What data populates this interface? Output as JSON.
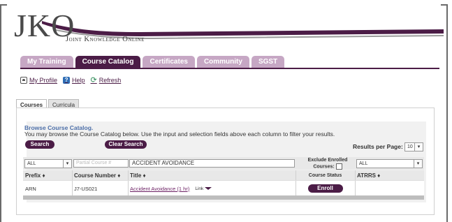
{
  "header": {
    "logo_text": "JKO",
    "logo_subtitle": "Joint Knowledge Online",
    "swoosh_colors": [
      "#4b1c46",
      "#8a8a8a"
    ]
  },
  "tabs": [
    {
      "label": "My Training",
      "active": false
    },
    {
      "label": "Course Catalog",
      "active": true
    },
    {
      "label": "Certificates",
      "active": false
    },
    {
      "label": "Community",
      "active": false
    },
    {
      "label": "SGST",
      "active": false
    }
  ],
  "utility_links": [
    {
      "label": "My Profile",
      "icon": "profile-icon"
    },
    {
      "label": "Help",
      "icon": "help-icon"
    },
    {
      "label": "Refresh",
      "icon": "refresh-icon"
    }
  ],
  "subtabs": [
    {
      "label": "Courses",
      "active": true
    },
    {
      "label": "Curricula",
      "active": false
    }
  ],
  "catalog": {
    "title": "Browse Course Catalog.",
    "description": "You may browse the Course Catalog below. Use the input and selection fields above each column to filter your results.",
    "search_label": "Search",
    "clear_search_label": "Clear Search",
    "results_per_page_label": "Results per Page:",
    "results_per_page_value": "10"
  },
  "filters": {
    "prefix_value": "ALL",
    "course_number_placeholder": "Partial Course #",
    "title_value": "ACCIDENT AVOIDANCE",
    "exclude_enrolled_label_1": "Exclude Enrolled",
    "exclude_enrolled_label_2": "Courses:",
    "atrrs_value": "ALL"
  },
  "columns": {
    "prefix": "Prefix ♦",
    "course_number": "Course Number ♦",
    "title": "Title ♦",
    "course_status": "Course Status",
    "atrrs": "ATRRS ♦"
  },
  "rows": [
    {
      "prefix": "ARN",
      "course_number": "J7-US021",
      "title": "Accident Avoidance (1 hr)",
      "link_menu": "Link",
      "action": "Enroll"
    }
  ],
  "colors": {
    "brand_purple": "#4b1c46",
    "tab_inactive": "#c6a7c4",
    "link_blue": "#4d6fa8"
  }
}
